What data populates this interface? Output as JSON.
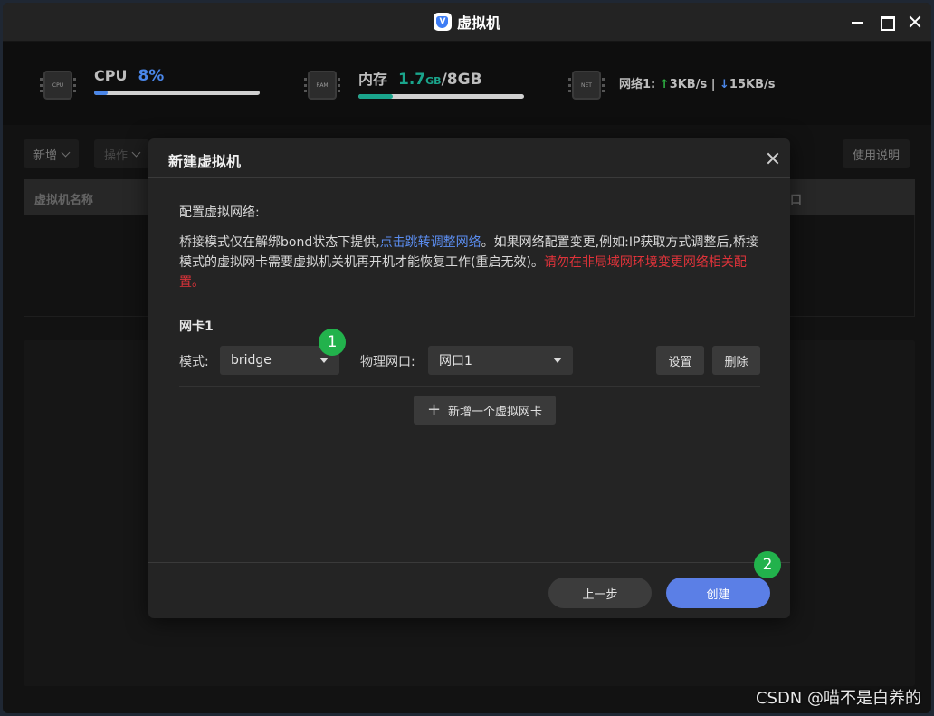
{
  "window": {
    "title": "虚拟机",
    "logo_glyph": "V"
  },
  "stats": {
    "cpu": {
      "label": "CPU",
      "value": "8%",
      "percent": 8,
      "chip_text": "CPU",
      "color": "#4a86e8"
    },
    "memory": {
      "label": "内存",
      "used": "1.7",
      "used_unit": "GB",
      "separator": "/",
      "total": "8",
      "total_unit": "GB",
      "percent": 21,
      "chip_text": "RAM",
      "color": "#1aa58c"
    },
    "network": {
      "label": "网络1:",
      "up_arrow": "↑",
      "up": "3KB/s",
      "divider": "|",
      "down_arrow": "↓",
      "down": "15KB/s",
      "chip_text": "NET"
    }
  },
  "toolbar": {
    "add_label": "新增",
    "ops_label": "操作",
    "help_label": "使用说明"
  },
  "table": {
    "col_name": "虚拟机名称",
    "col_partial": "口"
  },
  "dialog": {
    "title": "新建虚拟机",
    "section_title": "配置虚拟网络:",
    "desc_part1": "桥接模式仅在解绑bond状态下提供,",
    "desc_link": "点击跳转调整网络",
    "desc_part2": "。如果网络配置变更,例如:IP获取方式调整后,桥接模式的虚拟网卡需要虚拟机关机再开机才能恢复工作(重启无效)。",
    "desc_warn": "请勿在非局域网环境变更网络相关配置。",
    "nic_title": "网卡1",
    "mode_label": "模式:",
    "mode_value": "bridge",
    "port_label": "物理网口:",
    "port_value": "网口1",
    "settings_label": "设置",
    "delete_label": "删除",
    "add_nic_label": "新增一个虚拟网卡",
    "prev_label": "上一步",
    "create_label": "创建"
  },
  "annotations": {
    "badge1": "1",
    "badge2": "2"
  },
  "watermark": "CSDN @喵不是白养的"
}
